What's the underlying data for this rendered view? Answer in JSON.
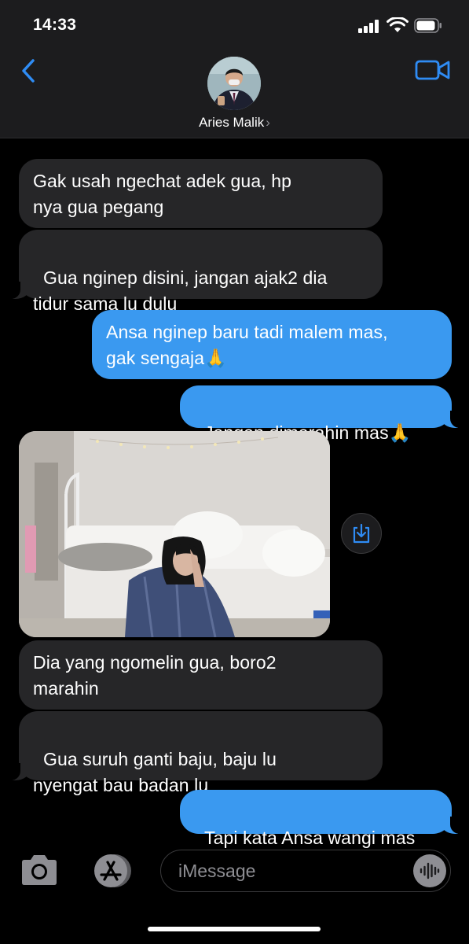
{
  "status_bar": {
    "time": "14:33"
  },
  "header": {
    "contact_name": "Aries Malik",
    "chevron": "›",
    "back_icon": "chevron-left-icon",
    "video_icon": "video-camera-icon"
  },
  "messages": [
    {
      "direction": "incoming",
      "text": "Gak usah ngechat adek gua, hp\nnya gua pegang"
    },
    {
      "direction": "incoming",
      "text": "Gua nginep disini, jangan ajak2 dia\ntidur sama lu dulu"
    },
    {
      "direction": "outgoing",
      "text": "Ansa nginep baru tadi malem mas,\ngak sengaja🙏"
    },
    {
      "direction": "outgoing",
      "text": "Jangan dimarahin mas🙏"
    },
    {
      "direction": "incoming",
      "type": "photo"
    },
    {
      "direction": "incoming",
      "text": "Dia yang ngomelin gua, boro2\nmarahin"
    },
    {
      "direction": "incoming",
      "text": "Gua suruh ganti baju, baju lu\nnyengat bau badan lu"
    },
    {
      "direction": "outgoing",
      "text": "Tapi kata Ansa wangi mas"
    }
  ],
  "composer": {
    "placeholder": "iMessage",
    "camera_icon": "camera-icon",
    "apps_icon": "app-store-icon",
    "audio_icon": "audio-waveform-icon"
  },
  "colors": {
    "outgoing_bubble": "#3a99f0",
    "incoming_bubble": "#262628",
    "accent": "#2f8cf4",
    "header_bg": "#1c1c1e"
  }
}
